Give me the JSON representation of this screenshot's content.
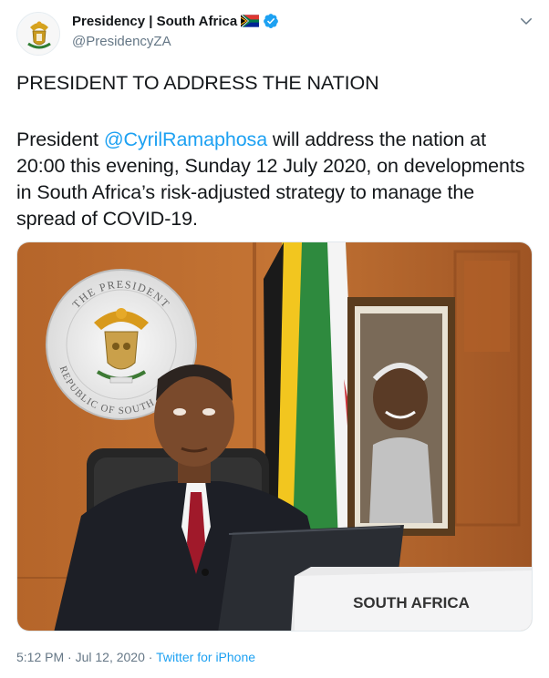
{
  "author": {
    "display_name": "Presidency | South Africa",
    "handle": "@PresidencyZA",
    "verified": true,
    "flag_icon": "south-africa-flag-icon"
  },
  "tweet": {
    "headline": "PRESIDENT TO ADDRESS THE NATION",
    "body_prefix": "President ",
    "mention": "@CyrilRamaphosa",
    "body_suffix": " will address the nation at 20:00 this evening, Sunday 12 July 2020, on developments in South Africa’s risk-adjusted strategy to manage the spread of COVID-19."
  },
  "photo": {
    "seal_text_top": "THE PRESIDENT",
    "seal_text_bottom": "REPUBLIC OF SOUTH AFRICA",
    "placard_text": "SOUTH AFRICA"
  },
  "meta": {
    "time": "5:12 PM",
    "separator": " · ",
    "date": "Jul 12, 2020",
    "source": "Twitter for iPhone"
  },
  "colors": {
    "link": "#1da1f2",
    "secondary_text": "#657786",
    "verified": "#1da1f2"
  }
}
